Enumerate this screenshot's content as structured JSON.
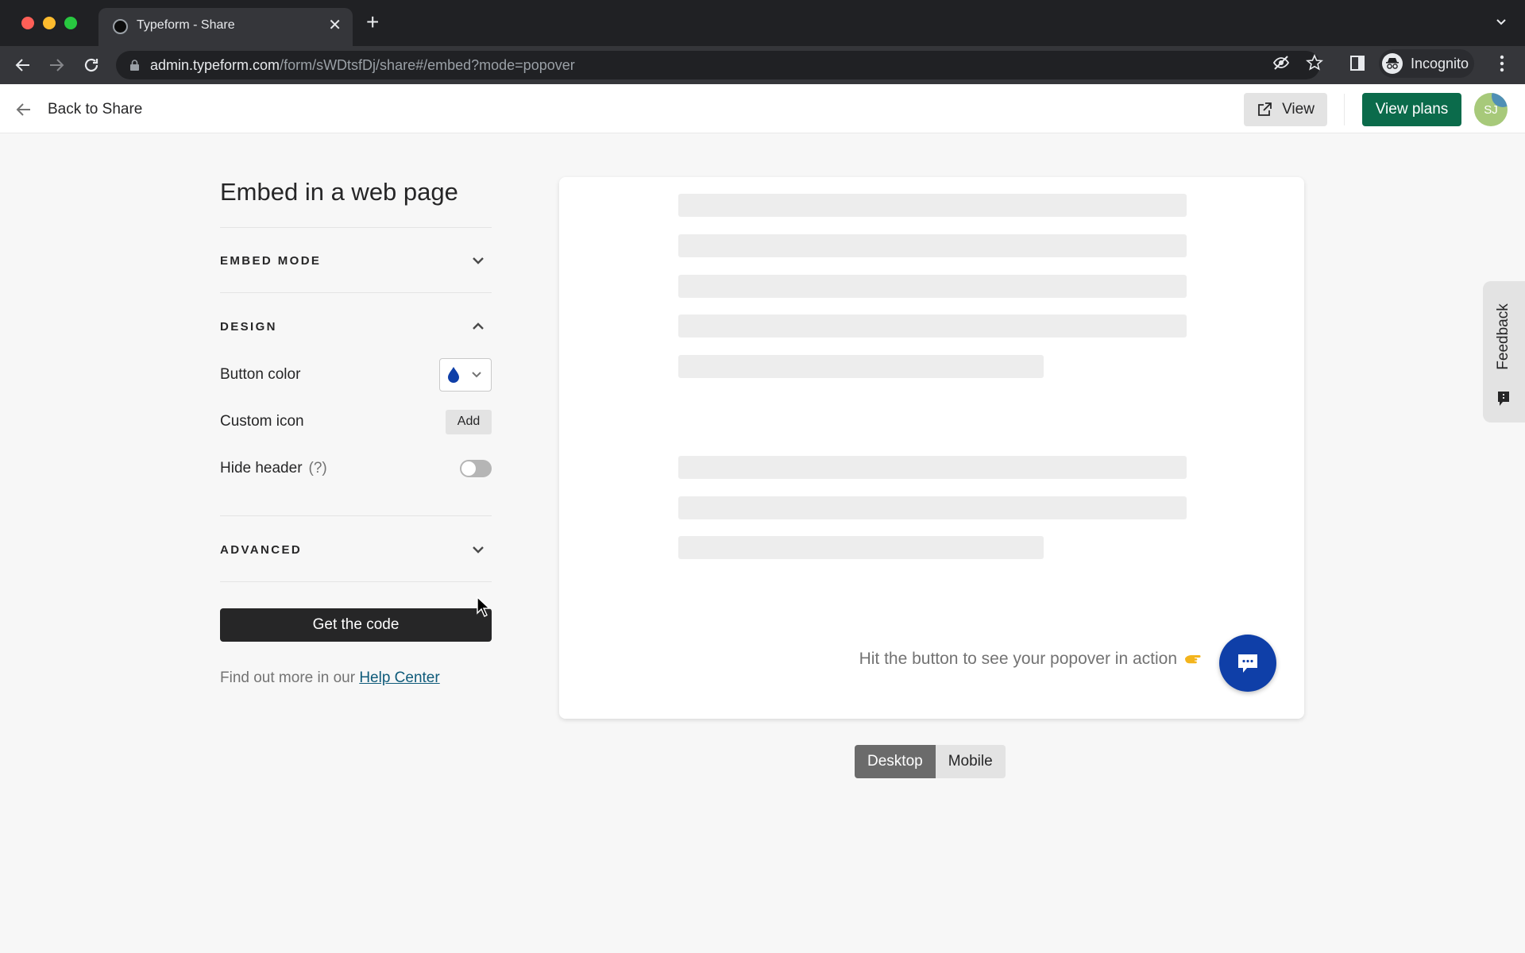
{
  "browser": {
    "tab_title": "Typeform - Share",
    "url_host": "admin.typeform.com",
    "url_path": "/form/sWDtsfDj/share#/embed?mode=popover",
    "profile_label": "Incognito",
    "icons": [
      "back-icon",
      "forward-icon",
      "reload-icon",
      "lock-icon",
      "eye-off-icon",
      "star-icon",
      "side-panel-icon",
      "incognito-icon",
      "kebab-menu-icon",
      "tab-list-icon",
      "new-tab-icon",
      "close-tab-icon"
    ]
  },
  "header": {
    "back_label": "Back to Share",
    "view_label": "View",
    "plans_label": "View plans",
    "avatar_initials": "SJ",
    "colors": {
      "plans_button": "#0b6b4b",
      "avatar": "#a7c97a"
    }
  },
  "panel": {
    "title": "Embed in a web page",
    "sections": {
      "embed_mode": {
        "title": "EMBED MODE",
        "expanded": false
      },
      "design": {
        "title": "DESIGN",
        "expanded": true,
        "button_color_label": "Button color",
        "button_color_value": "#0f3fa8",
        "custom_icon_label": "Custom icon",
        "custom_icon_action": "Add",
        "hide_header_label": "Hide header",
        "hide_header_hint": "(?)",
        "hide_header_enabled": false
      },
      "advanced": {
        "title": "ADVANCED",
        "expanded": false
      }
    },
    "get_code_label": "Get the code",
    "help_prefix": "Find out more in our ",
    "help_link": "Help Center"
  },
  "preview": {
    "hint": "Hit the button to see your popover in action",
    "hint_emoji": "pointing-right-hand",
    "devices": [
      {
        "label": "Desktop",
        "active": true
      },
      {
        "label": "Mobile",
        "active": false
      }
    ]
  },
  "feedback": {
    "label": "Feedback"
  }
}
